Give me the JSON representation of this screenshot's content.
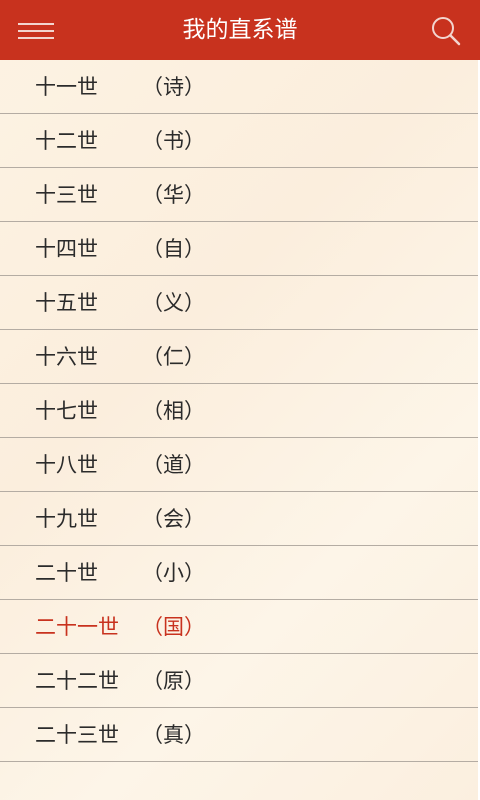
{
  "header": {
    "title": "我的直系谱",
    "menu_icon": "hamburger-menu-icon",
    "search_icon": "search-icon",
    "bg_color": "#c8321e"
  },
  "accent_color": "#c8321e",
  "generations": [
    {
      "gen": "十一世",
      "name": "（诗）",
      "active": false
    },
    {
      "gen": "十二世",
      "name": "（书）",
      "active": false
    },
    {
      "gen": "十三世",
      "name": "（华）",
      "active": false
    },
    {
      "gen": "十四世",
      "name": "（自）",
      "active": false
    },
    {
      "gen": "十五世",
      "name": "（义）",
      "active": false
    },
    {
      "gen": "十六世",
      "name": "（仁）",
      "active": false
    },
    {
      "gen": "十七世",
      "name": "（相）",
      "active": false
    },
    {
      "gen": "十八世",
      "name": "（道）",
      "active": false
    },
    {
      "gen": "十九世",
      "name": "（会）",
      "active": false
    },
    {
      "gen": "二十世",
      "name": "（小）",
      "active": false
    },
    {
      "gen": "二十一世",
      "name": "（国）",
      "active": true
    },
    {
      "gen": "二十二世",
      "name": "（原）",
      "active": false
    },
    {
      "gen": "二十三世",
      "name": "（真）",
      "active": false
    }
  ]
}
